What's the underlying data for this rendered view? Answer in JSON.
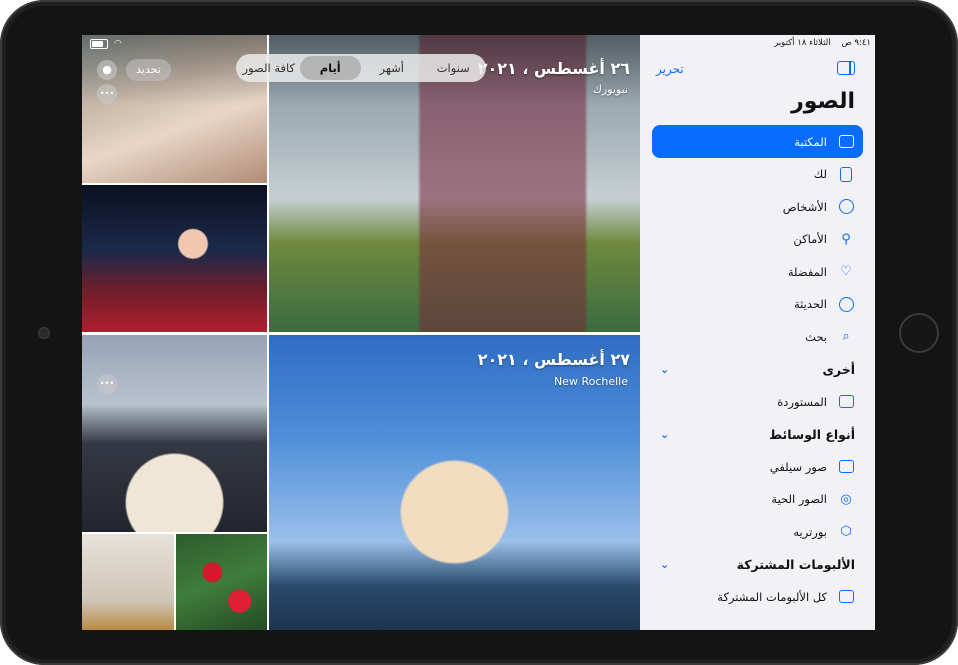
{
  "status_bar": {
    "time": "٩:٤١ ص",
    "date": "الثلاثاء ١٨ أكتوبر"
  },
  "toolbar": {
    "segments": [
      "سنوات",
      "أشهر",
      "أيام",
      "كافة الصور"
    ],
    "active_segment": "أيام",
    "select_label": "تحديد",
    "more_label": "•••"
  },
  "photo_groups": [
    {
      "date": "٢٦ أغسطس ، ٢٠٢١",
      "location": "نيويورك"
    },
    {
      "date": "٢٧ أغسطس ، ٢٠٢١",
      "location": "New Rochelle"
    }
  ],
  "sidebar": {
    "edit_label": "تحرير",
    "title": "الصور",
    "items": [
      {
        "label": "المكتبة",
        "icon": "library-icon",
        "selected": true
      },
      {
        "label": "لك",
        "icon": "for-you-icon"
      },
      {
        "label": "الأشخاص",
        "icon": "people-icon"
      },
      {
        "label": "الأماكن",
        "icon": "places-icon"
      },
      {
        "label": "المفضلة",
        "icon": "heart-icon"
      },
      {
        "label": "الحديثة",
        "icon": "clock-icon"
      },
      {
        "label": "بحث",
        "icon": "search-icon"
      }
    ],
    "sections": [
      {
        "title": "أخرى",
        "items": [
          {
            "label": "المستوردة",
            "icon": "import-icon"
          }
        ]
      },
      {
        "title": "أنواع الوسائط",
        "items": [
          {
            "label": "صور سيلفي",
            "icon": "selfie-icon"
          },
          {
            "label": "الصور الحية",
            "icon": "live-photo-icon"
          },
          {
            "label": "بورتريه",
            "icon": "portrait-cube-icon"
          }
        ]
      },
      {
        "title": "الألبومات المشتركة",
        "items": [
          {
            "label": "كل الألبومات المشتركة",
            "icon": "shared-albums-icon"
          }
        ]
      }
    ],
    "accent": "#0a6cff"
  }
}
